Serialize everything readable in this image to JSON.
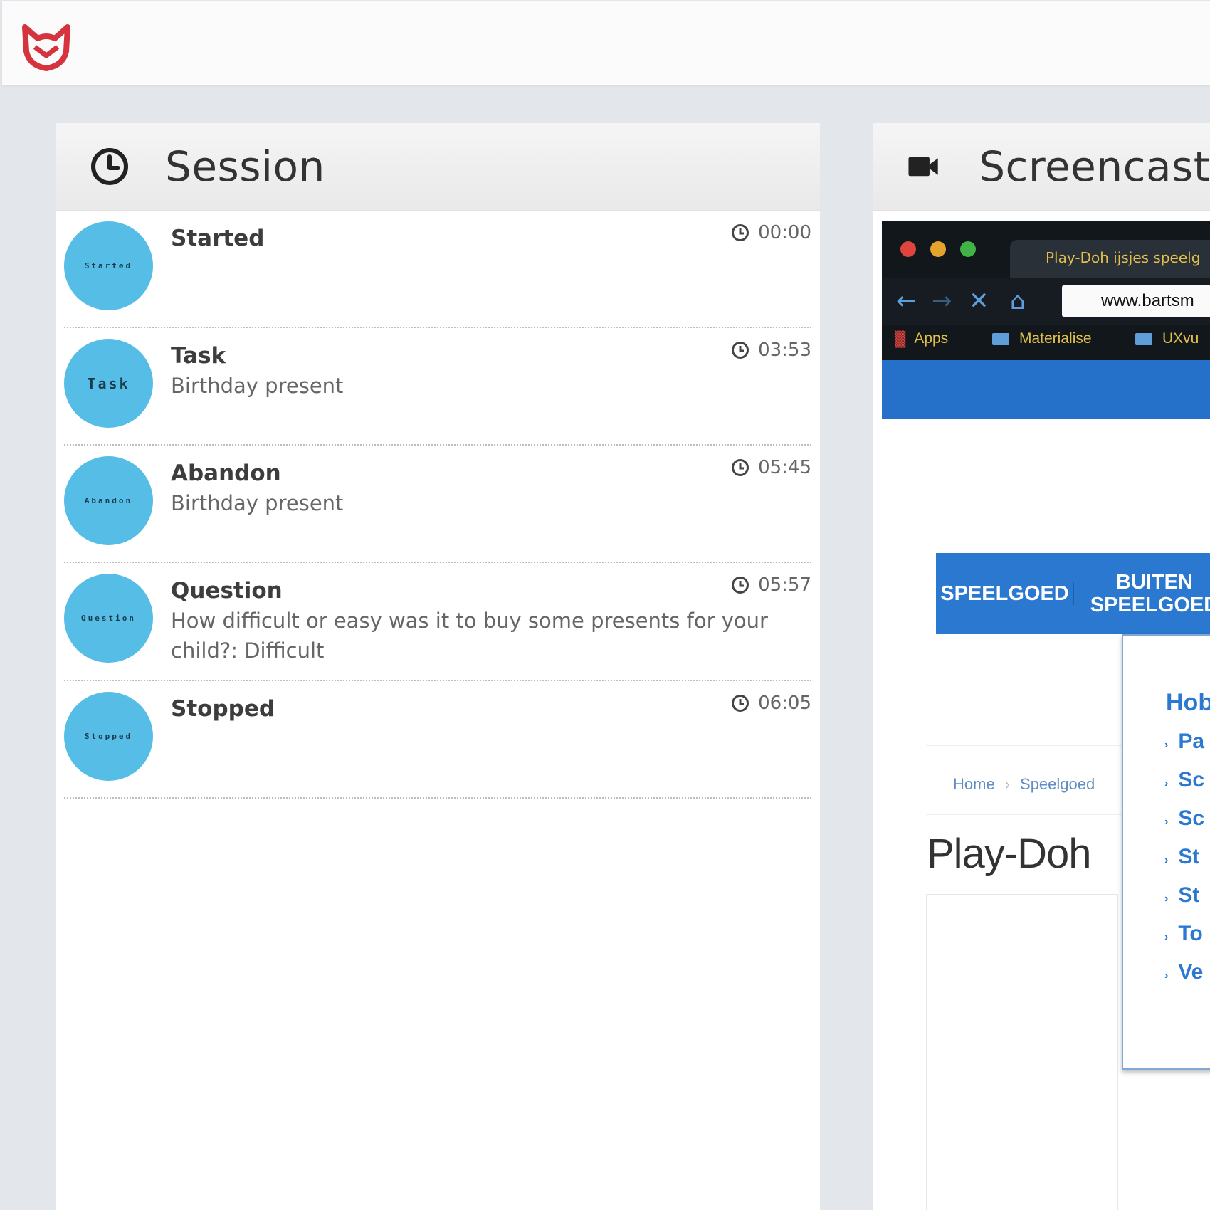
{
  "app": {
    "logo_icon": "cat-mask-logo-icon",
    "brand_color": "#d5343f"
  },
  "session": {
    "title": "Session",
    "icon": "clock-icon",
    "avatar_color": "#55bde6",
    "events": [
      {
        "avatar": "Started",
        "title": "Started",
        "description": "",
        "time": "00:00"
      },
      {
        "avatar": "Task",
        "title": "Task",
        "description": "Birthday present",
        "time": "03:53"
      },
      {
        "avatar": "Abandon",
        "title": "Abandon",
        "description": "Birthday present",
        "time": "05:45"
      },
      {
        "avatar": "Question",
        "title": "Question",
        "description": "How difficult or easy was it to buy some presents for your child?: Difficult",
        "time": "05:57"
      },
      {
        "avatar": "Stopped",
        "title": "Stopped",
        "description": "",
        "time": "06:05"
      }
    ]
  },
  "screencast": {
    "title": "Screencast",
    "icon": "video-camera-icon",
    "browser": {
      "tab_title": "Play-Doh ijsjes speelg",
      "url": "www.bartsm",
      "bookmarks": [
        "Apps",
        "Materialise",
        "UXvu"
      ]
    },
    "site": {
      "nav": [
        "SPEELGOED",
        "BUITEN SPEELGOED"
      ],
      "nav_second_line1": "BUITEN",
      "nav_second_line2": "SPEELGOED",
      "dropdown_heading": "Hob",
      "dropdown_items": [
        "Pa",
        "Sc",
        "Sc",
        "St",
        "St",
        "To",
        "Ve"
      ],
      "breadcrumb": [
        "Home",
        "Speelgoed"
      ],
      "page_title": "Play-Doh"
    }
  }
}
